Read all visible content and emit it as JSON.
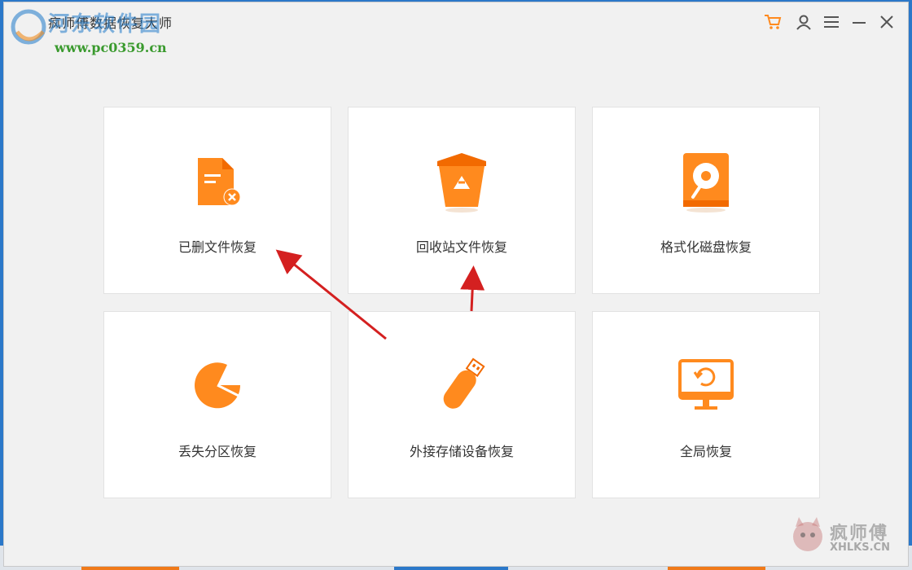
{
  "window": {
    "title": "疯师傅数据恢复大师"
  },
  "watermark": {
    "brand": "河东软件园",
    "url": "www.pc0359.cn",
    "corner_cn": "疯师傅",
    "corner_en": "XHLKS.CN"
  },
  "toolbar": {
    "cart_icon": "cart-icon",
    "user_icon": "user-icon",
    "menu_icon": "menu-icon",
    "minimize_icon": "minimize-icon",
    "close_icon": "close-icon"
  },
  "cards": [
    {
      "label": "已删文件恢复",
      "icon": "deleted-file-icon"
    },
    {
      "label": "回收站文件恢复",
      "icon": "recycle-bin-icon"
    },
    {
      "label": "格式化磁盘恢复",
      "icon": "formatted-disk-icon"
    },
    {
      "label": "丢失分区恢复",
      "icon": "lost-partition-icon"
    },
    {
      "label": "外接存储设备恢复",
      "icon": "usb-drive-icon"
    },
    {
      "label": "全局恢复",
      "icon": "monitor-restore-icon"
    }
  ],
  "colors": {
    "accent": "#ff8a1e",
    "accent_dark": "#f26a00",
    "arrow": "#d42020",
    "background": "#f1f1f1",
    "card": "#ffffff"
  }
}
